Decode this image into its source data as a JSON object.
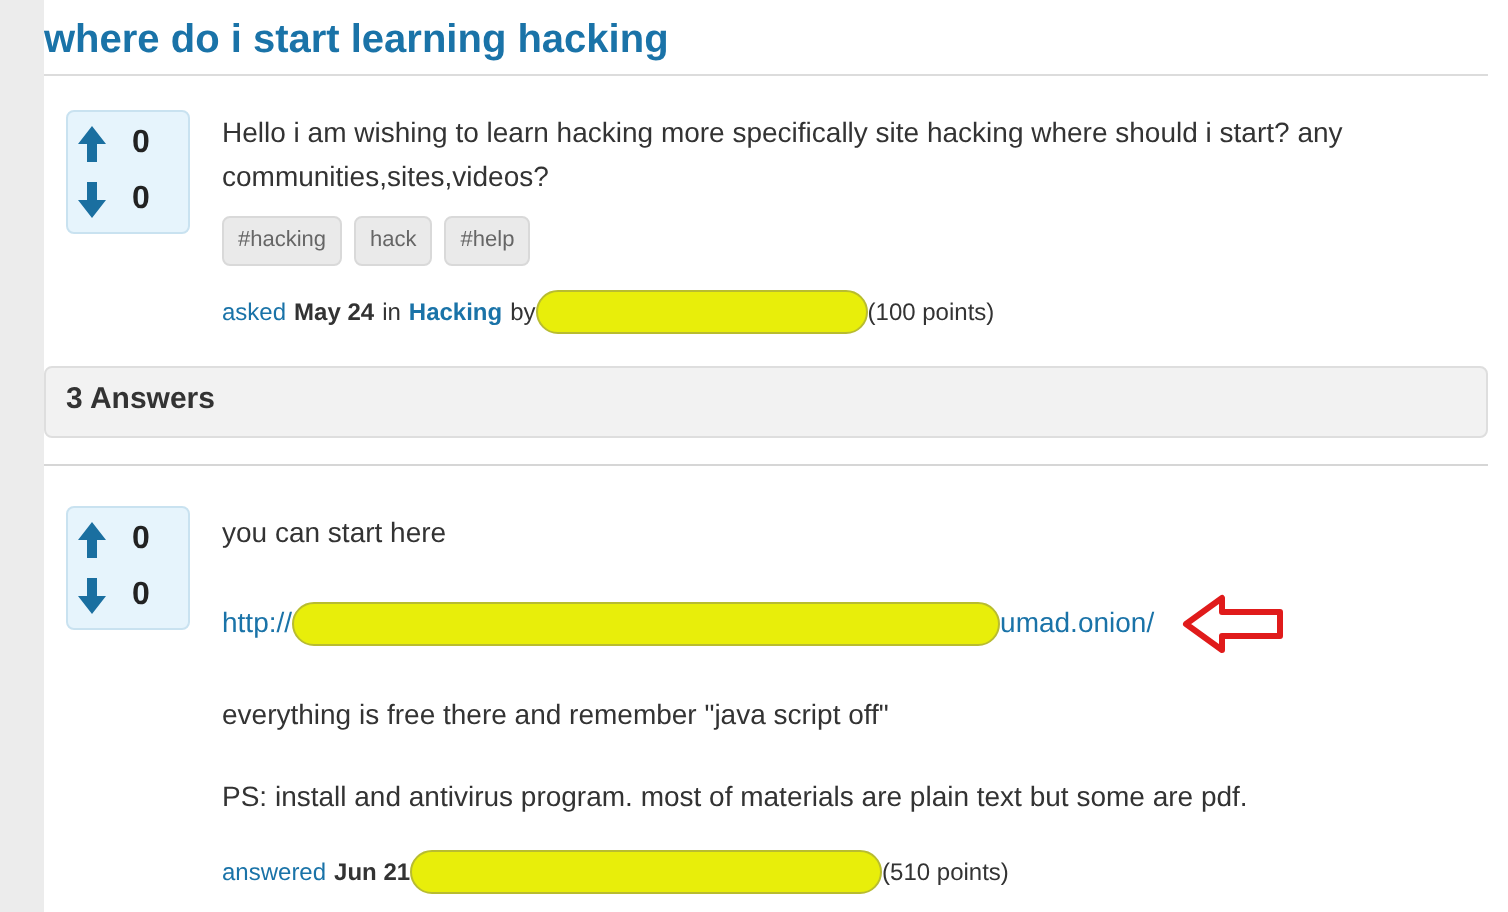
{
  "question": {
    "title": "where do i start learning hacking",
    "votes": {
      "up": "0",
      "down": "0"
    },
    "body": "Hello i am wishing to learn hacking more specifically site hacking where should i start? any communities,sites,videos?",
    "tags": [
      "#hacking",
      "hack",
      "#help"
    ],
    "meta": {
      "action": "asked",
      "date": "May 24",
      "in": "in",
      "category": "Hacking",
      "by": "by",
      "points": "(100 points)"
    }
  },
  "answers_header": "3 Answers",
  "answer": {
    "votes": {
      "up": "0",
      "down": "0"
    },
    "paragraphs": [
      {
        "kind": "text",
        "text": "you can start here"
      },
      {
        "kind": "link",
        "prefix": "http://",
        "suffix": "umad.onion/"
      },
      {
        "kind": "text",
        "text": "everything is free there and remember \"java script off\""
      },
      {
        "kind": "text",
        "text": "PS: install and antivirus program. most of materials are plain text but some are pdf."
      }
    ],
    "meta": {
      "action": "answered",
      "date": "Jun 21",
      "points": "(510 points)"
    }
  }
}
